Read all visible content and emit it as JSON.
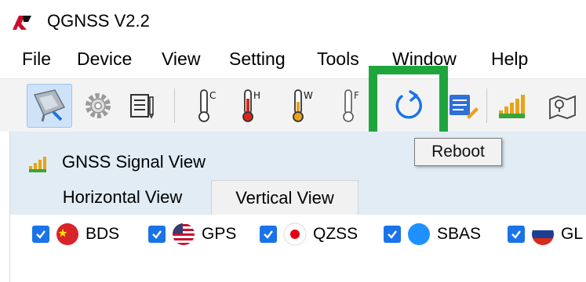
{
  "window": {
    "title": "QGNSS V2.2"
  },
  "menu": [
    "File",
    "Device",
    "View",
    "Setting",
    "Tools",
    "Window",
    "Help"
  ],
  "toolbar": {
    "buttons": [
      {
        "icon": "device-connect-icon"
      },
      {
        "icon": "settings-gear-icon"
      },
      {
        "icon": "data-log-icon"
      },
      {
        "icon": "cold-start-thermometer-icon",
        "badge": "C"
      },
      {
        "icon": "hot-start-thermometer-icon",
        "badge": "H"
      },
      {
        "icon": "warm-start-thermometer-icon",
        "badge": "W"
      },
      {
        "icon": "factory-start-thermometer-icon",
        "badge": "F"
      },
      {
        "icon": "reboot-icon"
      },
      {
        "icon": "config-edit-icon"
      },
      {
        "icon": "signal-bars-icon"
      },
      {
        "icon": "map-view-icon"
      }
    ],
    "tooltip": "Reboot"
  },
  "signal_view": {
    "title": "GNSS Signal View",
    "tabs": [
      "Horizontal View",
      "Vertical View"
    ],
    "filters": [
      {
        "label": "BDS",
        "checked": true,
        "color": "#d8232a"
      },
      {
        "label": "GPS",
        "checked": true,
        "color": "#3c5aa6"
      },
      {
        "label": "QZSS",
        "checked": true,
        "color": "#e60012"
      },
      {
        "label": "SBAS",
        "checked": true,
        "color": "#1e90ff"
      },
      {
        "label": "GL",
        "checked": true,
        "color": "#d52b1e"
      }
    ]
  },
  "colors": {
    "highlight": "#1ea63c",
    "accent": "#1a73e8"
  }
}
